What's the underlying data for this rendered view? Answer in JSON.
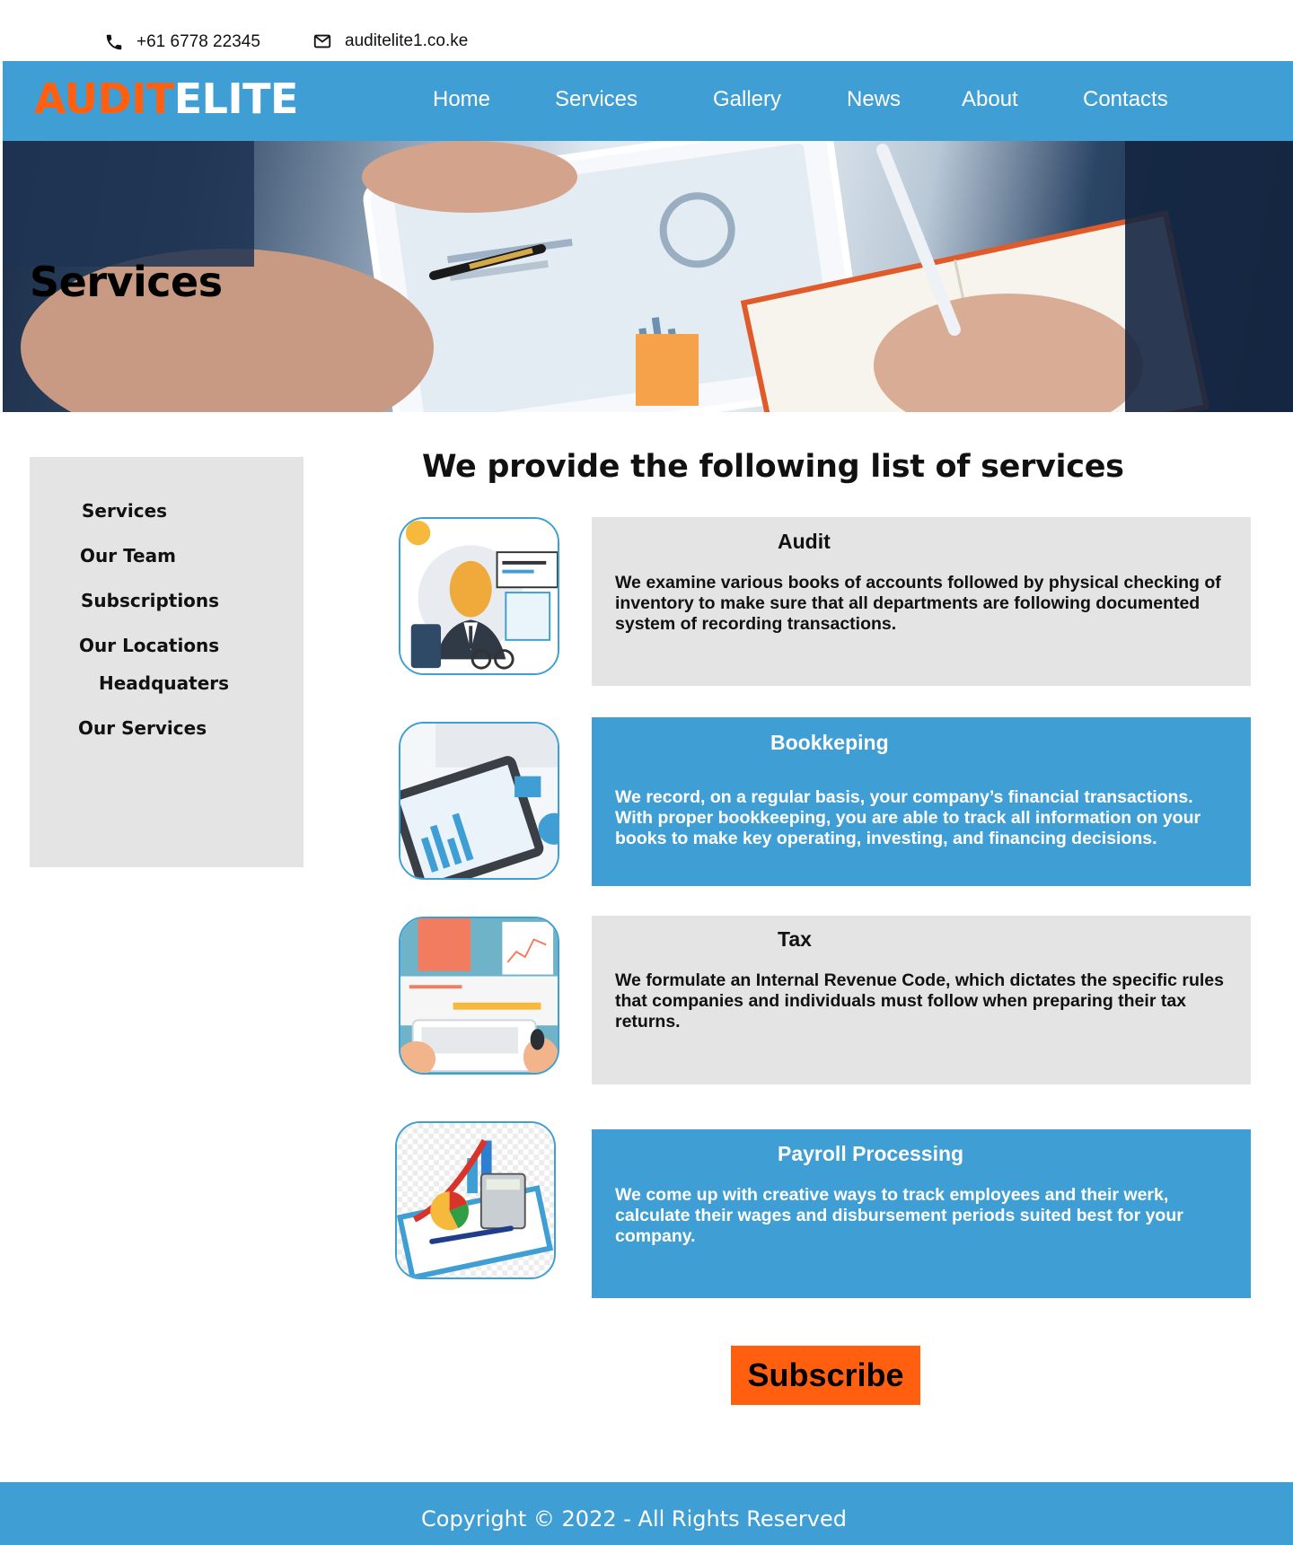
{
  "contact": {
    "phone": "+61 6778 22345",
    "email": "auditelite1.co.ke"
  },
  "brand": {
    "part1": "AUDIT",
    "part2": "ELITE"
  },
  "nav": {
    "items": [
      "Home",
      "Services",
      "Gallery",
      "News",
      "About",
      "Contacts"
    ]
  },
  "hero": {
    "title": "Services"
  },
  "sidebar": {
    "items": [
      "Services",
      "Our Team",
      "Subscriptions",
      "Our Locations",
      "Headquaters",
      "Our Services"
    ]
  },
  "main": {
    "heading": "We provide the following list of services",
    "services": [
      {
        "title": "Audit",
        "text": "We examine  various books of accounts followed by physical checking of inventory to make sure that all departments are following documented system of recording transactions."
      },
      {
        "title": "Bookkeping",
        "text": " We record, on a regular basis, your company’s financial transactions. With proper bookkeeping, you are able to track all information on your books to make key operating, investing, and financing decisions."
      },
      {
        "title": "Tax",
        "text": "We formulate an Internal Revenue Code, which dictates the specific rules that companies and individuals must follow when preparing their tax returns."
      },
      {
        "title": "Payroll Processing",
        "text": "We come up with creative ways to track employees and their werk, calculate their wages and disbursement periods suited best for your company."
      }
    ]
  },
  "subscribe": {
    "label": "Subscribe"
  },
  "footer": {
    "copyright": "Copyright © 2022 - All Rights Reserved"
  },
  "colors": {
    "primary_blue": "#3f9ed3",
    "accent_orange": "#ff5f0f",
    "panel_grey": "#e4e4e4"
  },
  "icons": [
    "phone-icon",
    "mail-icon"
  ]
}
